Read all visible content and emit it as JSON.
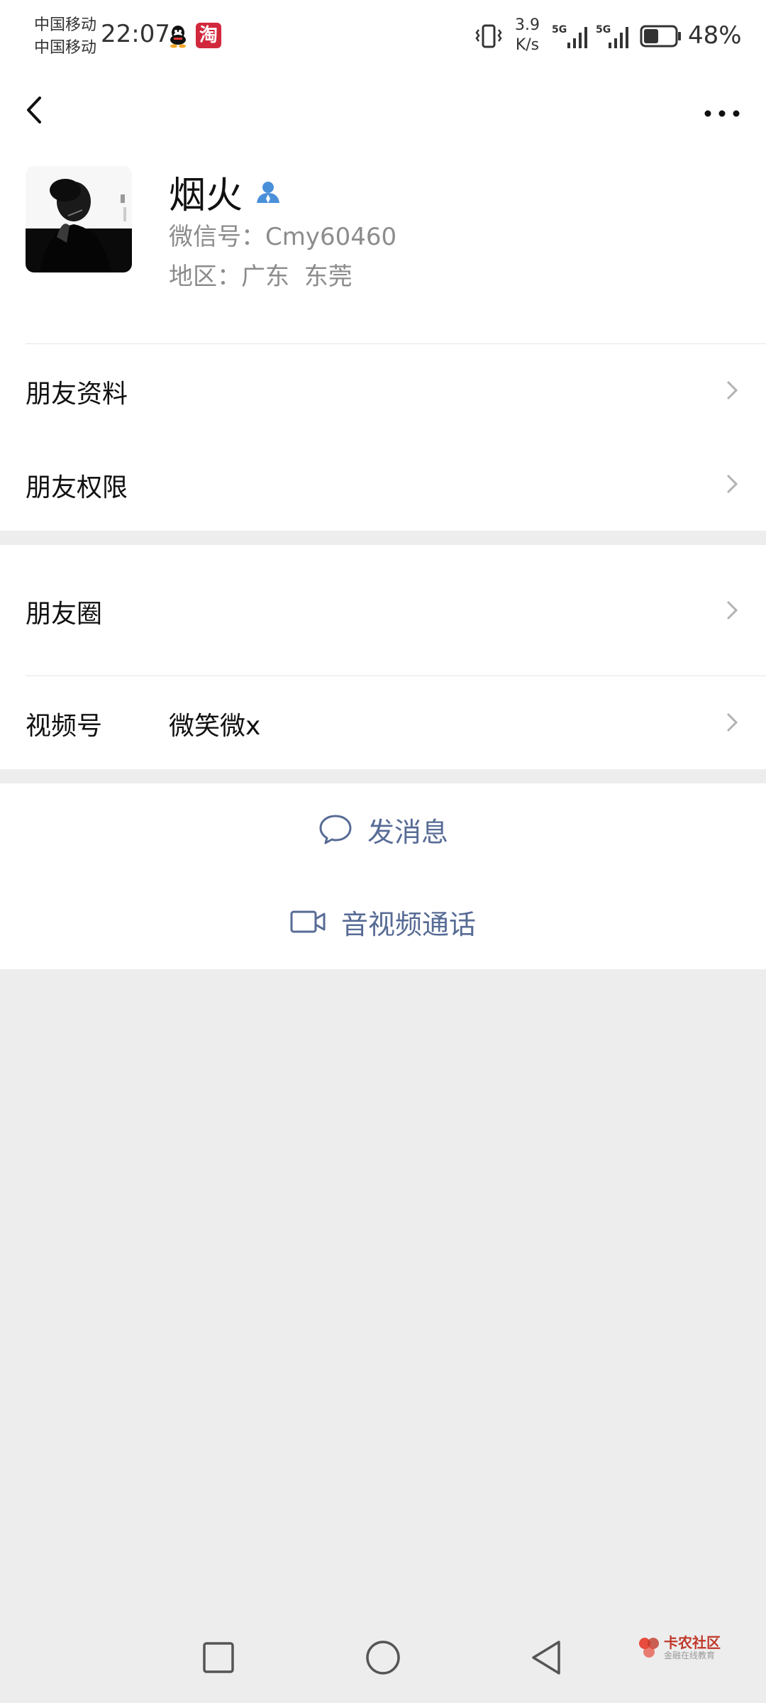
{
  "status_bar": {
    "carrier_1": "中国移动",
    "carrier_2": "中国移动",
    "time": "22:07",
    "apps": [
      "qq-icon",
      "taobao-icon"
    ],
    "taobao_glyph": "淘",
    "net_speed_value": "3.9",
    "net_speed_unit": "K/s",
    "signal_labels": [
      "5G",
      "5G"
    ],
    "battery_percent": "48%",
    "battery_level": 0.48
  },
  "nav": {
    "back_icon": "chevron-left-icon",
    "more_icon": "more-dots-icon"
  },
  "profile": {
    "name": "烟火",
    "verified_icon": "person-icon",
    "wechat_id": "微信号：Cmy60460",
    "region_label": "地区：",
    "region_value": "广东  东莞"
  },
  "menu": {
    "friend_info": "朋友资料",
    "friend_permissions": "朋友权限",
    "moments": "朋友圈",
    "channels_label": "视频号",
    "channels_value": "微笑微x"
  },
  "actions": {
    "send_message": "发消息",
    "video_call": "音视频通话"
  },
  "watermark": {
    "title": "卡农社区",
    "subtitle": "金融在线教育"
  },
  "colors": {
    "accent": "#576b95",
    "background": "#ededed",
    "verified": "#4a90d9"
  }
}
